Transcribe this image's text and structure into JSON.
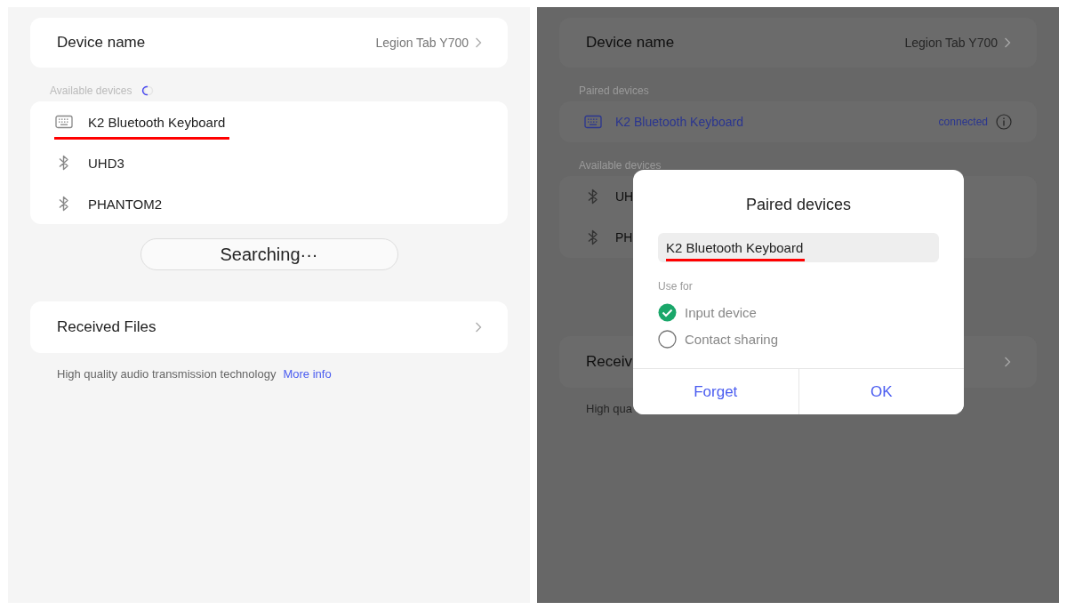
{
  "left": {
    "device_name": {
      "label": "Device name",
      "value": "Legion Tab Y700"
    },
    "available": {
      "label": "Available devices",
      "searching": true,
      "devices": [
        {
          "kind": "keyboard",
          "name": "K2 Bluetooth Keyboard",
          "underlined": true
        },
        {
          "kind": "bluetooth",
          "name": "UHD3",
          "underlined": false
        },
        {
          "kind": "bluetooth",
          "name": "PHANTOM2",
          "underlined": false
        }
      ]
    },
    "search_button": "Searching···",
    "received_files": "Received Files",
    "footer": {
      "text": "High quality audio transmission technology",
      "link": "More info"
    }
  },
  "right": {
    "device_name": {
      "label": "Device name",
      "value": "Legion Tab Y700"
    },
    "paired": {
      "label": "Paired devices",
      "devices": [
        {
          "kind": "keyboard",
          "name": "K2 Bluetooth Keyboard",
          "status": "connected"
        }
      ]
    },
    "available": {
      "label": "Available devices",
      "devices": [
        {
          "kind": "bluetooth",
          "name": "UH",
          "underlined": false
        },
        {
          "kind": "bluetooth",
          "name": "PH",
          "underlined": false
        }
      ]
    },
    "received_files": "Receiv",
    "footer": {
      "text": "High qua"
    },
    "dialog": {
      "title": "Paired devices",
      "field_value": "K2 Bluetooth Keyboard",
      "underlined": true,
      "section_label": "Use for",
      "options": [
        {
          "label": "Input device",
          "checked": true
        },
        {
          "label": "Contact sharing",
          "checked": false
        }
      ],
      "buttons": [
        "Forget",
        "OK"
      ]
    }
  }
}
